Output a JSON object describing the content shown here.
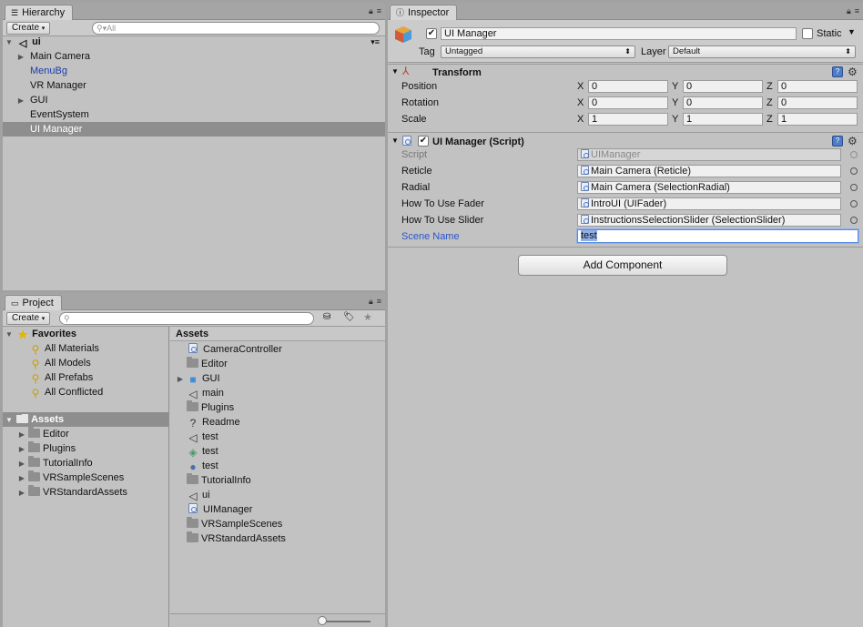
{
  "hierarchy": {
    "tab_title": "Hierarchy",
    "create_label": "Create",
    "search_placeholder": "All",
    "scene_name": "ui",
    "items": [
      {
        "label": "Main Camera",
        "expandable": true,
        "prefab": false,
        "selected": false
      },
      {
        "label": "MenuBg",
        "expandable": false,
        "prefab": true,
        "selected": false
      },
      {
        "label": "VR Manager",
        "expandable": false,
        "prefab": false,
        "selected": false
      },
      {
        "label": "GUI",
        "expandable": true,
        "prefab": false,
        "selected": false
      },
      {
        "label": "EventSystem",
        "expandable": false,
        "prefab": false,
        "selected": false
      },
      {
        "label": "UI Manager",
        "expandable": false,
        "prefab": false,
        "selected": true
      }
    ]
  },
  "project": {
    "tab_title": "Project",
    "create_label": "Create",
    "favorites_label": "Favorites",
    "favorites": [
      "All Materials",
      "All Models",
      "All Prefabs",
      "All Conflicted"
    ],
    "assets_label": "Assets",
    "asset_folders": [
      "Editor",
      "Plugins",
      "TutorialInfo",
      "VRSampleScenes",
      "VRStandardAssets"
    ],
    "assets_header": "Assets",
    "assets": [
      {
        "label": "CameraController",
        "icon": "script-icon",
        "expandable": false
      },
      {
        "label": "Editor",
        "icon": "folder-icon",
        "expandable": false
      },
      {
        "label": "GUI",
        "icon": "prefab-icon",
        "expandable": true
      },
      {
        "label": "main",
        "icon": "unity-scene-icon",
        "expandable": false
      },
      {
        "label": "Plugins",
        "icon": "folder-icon",
        "expandable": false
      },
      {
        "label": "Readme",
        "icon": "unknown-file-icon",
        "expandable": false
      },
      {
        "label": "test",
        "icon": "unity-scene-icon",
        "expandable": false
      },
      {
        "label": "test",
        "icon": "model-icon",
        "expandable": false
      },
      {
        "label": "test",
        "icon": "material-sphere-icon",
        "expandable": false
      },
      {
        "label": "TutorialInfo",
        "icon": "folder-icon",
        "expandable": false
      },
      {
        "label": "ui",
        "icon": "unity-scene-icon",
        "expandable": false
      },
      {
        "label": "UIManager",
        "icon": "script-icon",
        "expandable": false
      },
      {
        "label": "VRSampleScenes",
        "icon": "folder-icon",
        "expandable": false
      },
      {
        "label": "VRStandardAssets",
        "icon": "folder-icon",
        "expandable": false
      }
    ]
  },
  "inspector": {
    "tab_title": "Inspector",
    "object_name": "UI Manager",
    "static_label": "Static",
    "tag_label": "Tag",
    "tag_value": "Untagged",
    "layer_label": "Layer",
    "layer_value": "Default",
    "transform": {
      "title": "Transform",
      "rows": [
        {
          "label": "Position",
          "x": "0",
          "y": "0",
          "z": "0"
        },
        {
          "label": "Rotation",
          "x": "0",
          "y": "0",
          "z": "0"
        },
        {
          "label": "Scale",
          "x": "1",
          "y": "1",
          "z": "1"
        }
      ],
      "axis_x": "X",
      "axis_y": "Y",
      "axis_z": "Z"
    },
    "script_component": {
      "title": "UI Manager (Script)",
      "fields": [
        {
          "label": "Script",
          "value": "UIManager"
        },
        {
          "label": "Reticle",
          "value": "Main Camera (Reticle)"
        },
        {
          "label": "Radial",
          "value": "Main Camera (SelectionRadial)"
        },
        {
          "label": "How To Use Fader",
          "value": "IntroUI (UIFader)"
        },
        {
          "label": "How To Use Slider",
          "value": "InstructionsSelectionSlider (SelectionSlider)"
        }
      ],
      "scene_name_label": "Scene Name",
      "scene_name_value": "test"
    },
    "add_component_label": "Add Component"
  },
  "colors": {
    "selection": "#8e8e8e",
    "prefab_text": "#1c3ea8",
    "focus_label": "#2a55c9",
    "text_highlight": "#5a8de0"
  }
}
